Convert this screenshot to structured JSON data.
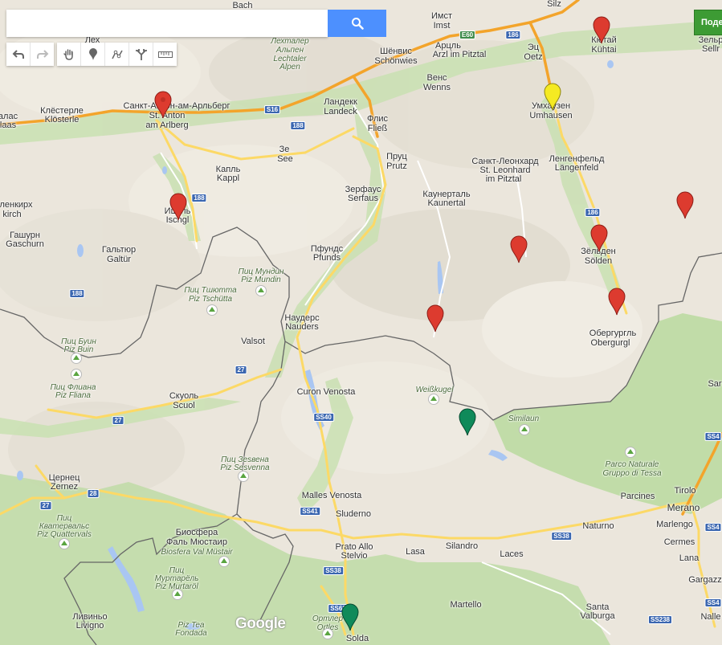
{
  "search": {
    "value": "",
    "placeholder": "",
    "button_icon": "search-icon"
  },
  "share_button": {
    "label": "Поде"
  },
  "toolbar": {
    "buttons": [
      {
        "name": "undo",
        "icon": "undo-icon"
      },
      {
        "name": "redo",
        "icon": "redo-icon"
      },
      {
        "name": "pan",
        "icon": "hand-icon"
      },
      {
        "name": "add-marker",
        "icon": "marker-icon"
      },
      {
        "name": "draw-line",
        "icon": "line-icon"
      },
      {
        "name": "directions",
        "icon": "route-icon"
      },
      {
        "name": "measure",
        "icon": "ruler-icon"
      }
    ]
  },
  "logo": "Google",
  "colors": {
    "water": "#a9c6f2",
    "protected_area": "#c3deaa",
    "highway": "#f5a623",
    "road": "#fcd96f",
    "border": "#555555",
    "marker_red": "#dd3b2f",
    "marker_yellow": "#f5ea22",
    "marker_green": "#0f8a5a",
    "search_button": "#4d90fe",
    "share_button": "#3d9b34"
  },
  "places": [
    {
      "text": "Bach"
    },
    {
      "text": "Имст"
    },
    {
      "text": "Imst"
    },
    {
      "text": "Silz"
    },
    {
      "text": "Лех"
    },
    {
      "text": "Лехталер"
    },
    {
      "text": "Альпен"
    },
    {
      "text": "Lechtaler"
    },
    {
      "text": "Alpen"
    },
    {
      "text": "Шёнвис"
    },
    {
      "text": "Schönwies"
    },
    {
      "text": "Арцль"
    },
    {
      "text": "Arzl im Pitztal"
    },
    {
      "text": "Эц"
    },
    {
      "text": "Oetz"
    },
    {
      "text": "Кютай"
    },
    {
      "text": "Kühtai"
    },
    {
      "text": "Зельр"
    },
    {
      "text": "Sellr"
    },
    {
      "text": "Венс"
    },
    {
      "text": "Wenns"
    },
    {
      "text": "Клёстерле"
    },
    {
      "text": "Klösterle"
    },
    {
      "text": "Санкт-Антон-ам-Арльберг"
    },
    {
      "text": "St. Anton"
    },
    {
      "text": "am Arlberg"
    },
    {
      "text": "Ландекк"
    },
    {
      "text": "Landeck"
    },
    {
      "text": "Флис"
    },
    {
      "text": "Fließ"
    },
    {
      "text": "Умхаузен"
    },
    {
      "text": "Umhausen"
    },
    {
      "text": "алас"
    },
    {
      "text": "laas"
    },
    {
      "text": "Зе"
    },
    {
      "text": "See"
    },
    {
      "text": "Пруц"
    },
    {
      "text": "Prutz"
    },
    {
      "text": "Санкт-Леонхард"
    },
    {
      "text": "St. Leonhard"
    },
    {
      "text": "im Pitztal"
    },
    {
      "text": "Ленгенфельд"
    },
    {
      "text": "Längenfeld"
    },
    {
      "text": "Капль"
    },
    {
      "text": "Kappl"
    },
    {
      "text": "Зерфаус"
    },
    {
      "text": "Serfaus"
    },
    {
      "text": "Каунерталь"
    },
    {
      "text": "Kaunertal"
    },
    {
      "text": "ленкирх"
    },
    {
      "text": "kirch"
    },
    {
      "text": "Ишгль"
    },
    {
      "text": "Ischgl"
    },
    {
      "text": "Гашурн"
    },
    {
      "text": "Gaschurn"
    },
    {
      "text": "Гальтюр"
    },
    {
      "text": "Galtür"
    },
    {
      "text": "Пфундс"
    },
    {
      "text": "Pfunds"
    },
    {
      "text": "Зёльден"
    },
    {
      "text": "Sölden"
    },
    {
      "text": "Пиц Мундин"
    },
    {
      "text": "Piz Mundin"
    },
    {
      "text": "Пиц Тшютта"
    },
    {
      "text": "Piz Tschütta"
    },
    {
      "text": "Наудерс"
    },
    {
      "text": "Nauders"
    },
    {
      "text": "Обергургль"
    },
    {
      "text": "Obergurgl"
    },
    {
      "text": "Valsot"
    },
    {
      "text": "Пиц Буин"
    },
    {
      "text": "Piz Buin"
    },
    {
      "text": "Пиц Флиана"
    },
    {
      "text": "Piz Fliana"
    },
    {
      "text": "Curon Venosta"
    },
    {
      "text": "Weißkugel"
    },
    {
      "text": "Скуоль"
    },
    {
      "text": "Scuol"
    },
    {
      "text": "Similaun"
    },
    {
      "text": "Sar"
    },
    {
      "text": "Пиц Зеsвена"
    },
    {
      "text": "Piz Sesvenna"
    },
    {
      "text": "Parco Naturale"
    },
    {
      "text": "Gruppo di Tessa"
    },
    {
      "text": "Цернец"
    },
    {
      "text": "Zernez"
    },
    {
      "text": "Malles Venosta"
    },
    {
      "text": "Sluderno"
    },
    {
      "text": "Parcines"
    },
    {
      "text": "Tirolo"
    },
    {
      "text": "Merano"
    },
    {
      "text": "Пиц"
    },
    {
      "text": "Кватервальс"
    },
    {
      "text": "Piz Quattervals"
    },
    {
      "text": "Биосфера"
    },
    {
      "text": "Фаль Мюстаир"
    },
    {
      "text": "Biosfera Val Müstair"
    },
    {
      "text": "Naturno"
    },
    {
      "text": "Marlengo"
    },
    {
      "text": "Prato Allo"
    },
    {
      "text": "Stelvio"
    },
    {
      "text": "Silandro"
    },
    {
      "text": "Cermes"
    },
    {
      "text": "Lasa"
    },
    {
      "text": "Laces"
    },
    {
      "text": "Lana"
    },
    {
      "text": "Пиц"
    },
    {
      "text": "Муртарёль"
    },
    {
      "text": "Piz Murtaröl"
    },
    {
      "text": "Gargazz"
    },
    {
      "text": "Martello"
    },
    {
      "text": "Ливиньо"
    },
    {
      "text": "Livigno"
    },
    {
      "text": "Santa"
    },
    {
      "text": "Valburga"
    },
    {
      "text": "Nalle"
    },
    {
      "text": "Piz Tea"
    },
    {
      "text": "Fondada"
    },
    {
      "text": "Ортлер"
    },
    {
      "text": "Ortles"
    },
    {
      "text": "Solda"
    }
  ],
  "shields": [
    {
      "text": "E60"
    },
    {
      "text": "186"
    },
    {
      "text": "S16"
    },
    {
      "text": "188"
    },
    {
      "text": "188"
    },
    {
      "text": "186"
    },
    {
      "text": "188"
    },
    {
      "text": "27"
    },
    {
      "text": "27"
    },
    {
      "text": "SS40"
    },
    {
      "text": "28"
    },
    {
      "text": "27"
    },
    {
      "text": "SS41"
    },
    {
      "text": "SS38"
    },
    {
      "text": "SS38"
    },
    {
      "text": "SS62"
    },
    {
      "text": "SS238"
    },
    {
      "text": "SS4"
    },
    {
      "text": "SS4"
    },
    {
      "text": "SS4"
    }
  ],
  "markers": [
    {
      "color": "red"
    },
    {
      "color": "red"
    },
    {
      "color": "red"
    },
    {
      "color": "red"
    },
    {
      "color": "red"
    },
    {
      "color": "red"
    },
    {
      "color": "red"
    },
    {
      "color": "red"
    },
    {
      "color": "yellow"
    },
    {
      "color": "green"
    },
    {
      "color": "green"
    }
  ]
}
